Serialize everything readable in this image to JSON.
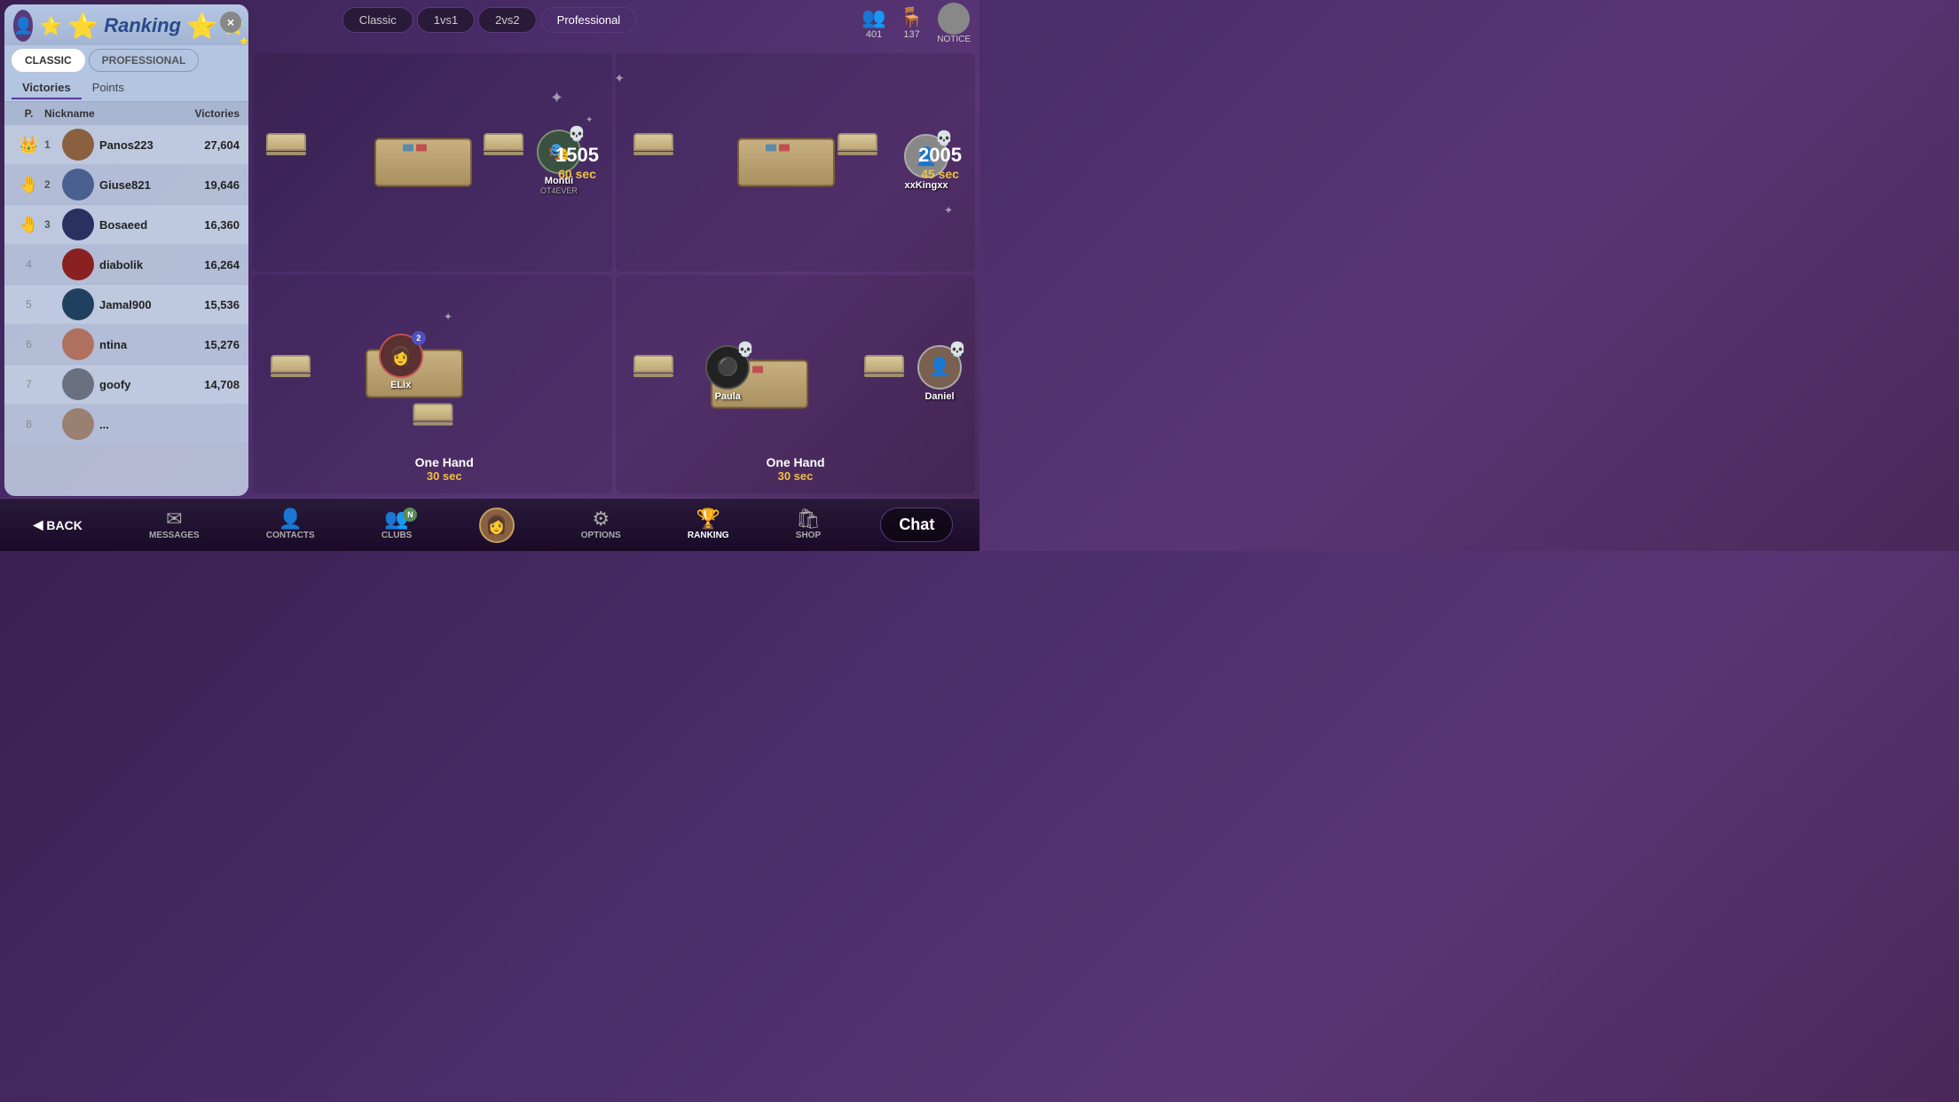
{
  "app": {
    "title": "Ranking"
  },
  "top_bar": {
    "mode_tabs": [
      {
        "id": "classic",
        "label": "Classic",
        "active": true
      },
      {
        "id": "1vs1",
        "label": "1vs1",
        "active": false
      },
      {
        "id": "2vs2",
        "label": "2vs2",
        "active": false
      },
      {
        "id": "professional",
        "label": "Professional",
        "active": false
      }
    ],
    "friends_count": "401",
    "tables_count": "137",
    "notice_label": "NOTICE"
  },
  "ranking_panel": {
    "title": "Ranking",
    "close_label": "×",
    "tabs": [
      {
        "id": "classic",
        "label": "CLASSIC",
        "active": true
      },
      {
        "id": "professional",
        "label": "PROFESSIONAL",
        "active": false
      }
    ],
    "filters": [
      {
        "id": "victories",
        "label": "Victories",
        "active": true
      },
      {
        "id": "points",
        "label": "Points",
        "active": false
      }
    ],
    "columns": {
      "position": "P.",
      "nickname": "Nickname",
      "victories": "Victories"
    },
    "players": [
      {
        "rank": 1,
        "medal": "👑",
        "name": "Panos223",
        "victories": "27,604",
        "av": "av-1"
      },
      {
        "rank": 2,
        "medal": "🤚",
        "name": "Giuse821",
        "victories": "19,646",
        "av": "av-2"
      },
      {
        "rank": 3,
        "medal": "🤚",
        "name": "Bosaeed",
        "victories": "16,360",
        "av": "av-3"
      },
      {
        "rank": 4,
        "medal": "",
        "name": "diabolik",
        "victories": "16,264",
        "av": "av-4"
      },
      {
        "rank": 5,
        "medal": "",
        "name": "Jamal900",
        "victories": "15,536",
        "av": "av-5"
      },
      {
        "rank": 6,
        "medal": "",
        "name": "ntina",
        "victories": "15,276",
        "av": "av-6"
      },
      {
        "rank": 7,
        "medal": "",
        "name": "goofy",
        "victories": "14,708",
        "av": "av-7"
      }
    ]
  },
  "game_tables": [
    {
      "id": "table1",
      "player": "Montii",
      "player_subtitle": "OT4EVER",
      "score": "1505",
      "time": "60 sec",
      "position": "top-left"
    },
    {
      "id": "table2",
      "player": "xxKingxx",
      "player_subtitle": "",
      "score": "2005",
      "time": "45 sec",
      "position": "top-right"
    },
    {
      "id": "table3",
      "player": "ELix",
      "player_subtitle": "",
      "table_type": "One Hand",
      "time": "30 sec",
      "position": "bottom-left"
    },
    {
      "id": "table4",
      "player1": "Paula",
      "player2": "Daniel",
      "table_type": "One Hand",
      "time": "30 sec",
      "position": "bottom-right"
    }
  ],
  "bottom_nav": {
    "back_label": "BACK",
    "items": [
      {
        "id": "messages",
        "label": "MESSAGES",
        "icon": "✉",
        "active": false,
        "badge": null
      },
      {
        "id": "contacts",
        "label": "CONTACTS",
        "icon": "👤",
        "active": false,
        "badge": null
      },
      {
        "id": "clubs",
        "label": "CLUBS",
        "icon": "👥",
        "active": false,
        "badge": "N"
      },
      {
        "id": "home",
        "label": "",
        "icon": "🎭",
        "active": false,
        "badge": null,
        "is_avatar": true
      },
      {
        "id": "options",
        "label": "OPTIONS",
        "icon": "⚙",
        "active": false,
        "badge": null
      },
      {
        "id": "ranking",
        "label": "RANKING",
        "icon": "🏆",
        "active": true,
        "badge": null
      },
      {
        "id": "shop",
        "label": "SHOP",
        "icon": "🛍",
        "active": false,
        "badge": null
      }
    ],
    "chat_label": "Chat"
  }
}
